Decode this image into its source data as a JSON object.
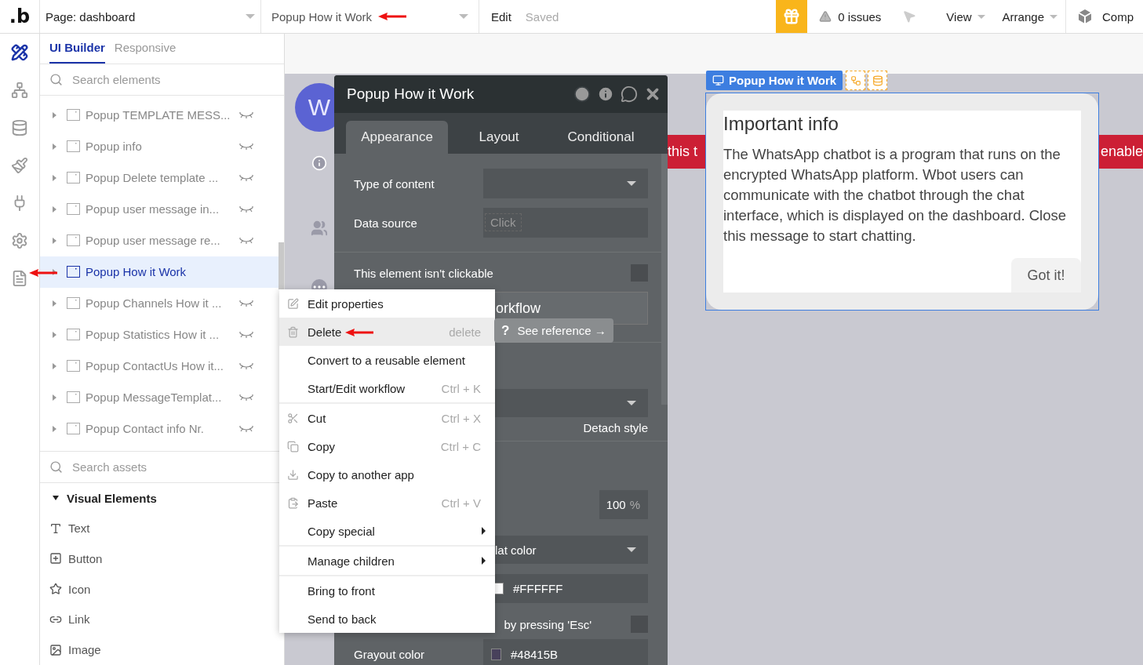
{
  "top_bar": {
    "logo": ".b",
    "page_selector": "Page: dashboard",
    "element_selector": "Popup How it Work",
    "edit_link": "Edit",
    "save_status": "Saved",
    "issues": "0 issues",
    "menus": [
      {
        "label": "View"
      },
      {
        "label": "Arrange"
      }
    ],
    "components": "Comp"
  },
  "icon_rail": [
    {
      "kind": "design",
      "selected": true
    },
    {
      "kind": "sitemap",
      "selected": false
    },
    {
      "kind": "data",
      "selected": false
    },
    {
      "kind": "styles",
      "selected": false
    },
    {
      "kind": "plugins",
      "selected": false
    },
    {
      "kind": "settings",
      "selected": false
    },
    {
      "kind": "logs",
      "selected": false
    }
  ],
  "sidebar": {
    "tabs": [
      {
        "label": "UI Builder",
        "selected": true
      },
      {
        "label": "Responsive",
        "selected": false
      }
    ],
    "element_search": {
      "placeholder": "Search elements"
    },
    "elements": [
      {
        "label": "Popup TEMPLATE MESS...",
        "selected": false,
        "hidden": true
      },
      {
        "label": "Popup info",
        "selected": false,
        "hidden": true
      },
      {
        "label": "Popup Delete template ...",
        "selected": false,
        "hidden": true
      },
      {
        "label": "Popup user message in...",
        "selected": false,
        "hidden": true
      },
      {
        "label": "Popup user message re...",
        "selected": false,
        "hidden": true
      },
      {
        "label": "Popup How it Work",
        "selected": true,
        "hidden": false
      },
      {
        "label": "Popup Channels How it ...",
        "selected": false,
        "hidden": true
      },
      {
        "label": "Popup Statistics How it ...",
        "selected": false,
        "hidden": true
      },
      {
        "label": "Popup ContactUs How it...",
        "selected": false,
        "hidden": true
      },
      {
        "label": "Popup MessageTemplat...",
        "selected": false,
        "hidden": true
      },
      {
        "label": "Popup Contact info Nr.",
        "selected": false,
        "hidden": true
      }
    ],
    "asset_search": {
      "placeholder": "Search assets"
    },
    "asset_group": {
      "label": "Visual Elements",
      "expanded": true
    },
    "assets": [
      {
        "kind": "text",
        "label": "Text"
      },
      {
        "kind": "button",
        "label": "Button"
      },
      {
        "kind": "icon",
        "label": "Icon"
      },
      {
        "kind": "link",
        "label": "Link"
      },
      {
        "kind": "image",
        "label": "Image"
      }
    ]
  },
  "canvas": {
    "selection_tag": "Popup How it Work",
    "avatar": "W",
    "banner_left": "this t",
    "banner_right": "enable",
    "popup": {
      "title": "Important info",
      "body": "The WhatsApp chatbot is a program that runs on the encrypted WhatsApp platform. Wbot users can communicate with the chatbot through the chat interface, which is displayed on the dashboard. Close this message to start chatting.",
      "button": "Got it!"
    }
  },
  "property_editor": {
    "title": "Popup How it Work",
    "tabs": [
      {
        "label": "Appearance",
        "selected": true
      },
      {
        "label": "Layout",
        "selected": false
      },
      {
        "label": "Conditional",
        "selected": false
      }
    ],
    "type_of_content": {
      "label": "Type of content"
    },
    "data_source": {
      "label": "Data source",
      "placeholder": "Click"
    },
    "not_clickable": {
      "label": "This element isn't clickable",
      "checked": false
    },
    "workflow_field": "orkflow",
    "see_reference": {
      "glyph": "?",
      "label": "See reference →"
    },
    "detach_style": "Detach style",
    "opacity": {
      "value": "100",
      "unit": "%"
    },
    "fill_style": "lat color",
    "fill_color": "#FFFFFF",
    "esc_close": {
      "label": "by pressing 'Esc'",
      "checked": false
    },
    "grayout": {
      "label": "Grayout color",
      "value": "#48415B"
    }
  },
  "context_menu": {
    "groups": [
      {
        "items": [
          {
            "kind": "edit",
            "label": "Edit properties",
            "selected": false
          },
          {
            "kind": "trash",
            "label": "Delete",
            "shortcut": "delete",
            "selected": true
          },
          {
            "kind": "plain",
            "label": "Convert to a reusable element",
            "selected": false
          },
          {
            "kind": "plain",
            "label": "Start/Edit workflow",
            "shortcut": "Ctrl + K",
            "selected": false
          }
        ]
      },
      {
        "items": [
          {
            "kind": "cut",
            "label": "Cut",
            "shortcut": "Ctrl + X",
            "selected": false
          },
          {
            "kind": "copy",
            "label": "Copy",
            "shortcut": "Ctrl + C",
            "selected": false
          },
          {
            "kind": "download",
            "label": "Copy to another app",
            "selected": false
          },
          {
            "kind": "paste",
            "label": "Paste",
            "shortcut": "Ctrl + V",
            "selected": false
          },
          {
            "kind": "plain",
            "label": "Copy special",
            "submenu": true,
            "selected": false
          }
        ]
      },
      {
        "items": [
          {
            "kind": "plain",
            "label": "Manage children",
            "submenu": true,
            "selected": false
          }
        ]
      },
      {
        "items": [
          {
            "kind": "plain",
            "label": "Bring to front",
            "selected": false
          },
          {
            "kind": "plain",
            "label": "Send to back",
            "selected": false
          }
        ]
      }
    ]
  }
}
